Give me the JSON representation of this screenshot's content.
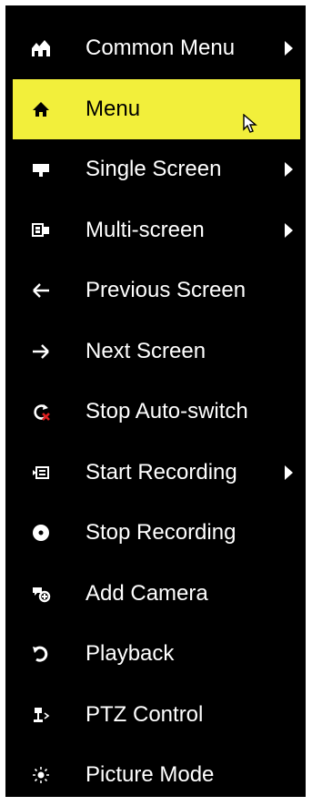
{
  "menu": {
    "items": [
      {
        "label": "Common Menu",
        "icon": "double-house-icon",
        "submenu": true
      },
      {
        "label": "Menu",
        "icon": "home-icon",
        "submenu": false,
        "highlighted": true
      },
      {
        "label": "Single Screen",
        "icon": "monitor-icon",
        "submenu": true
      },
      {
        "label": "Multi-screen",
        "icon": "multi-screen-icon",
        "submenu": true
      },
      {
        "label": "Previous Screen",
        "icon": "arrow-left-icon",
        "submenu": false
      },
      {
        "label": "Next Screen",
        "icon": "arrow-right-icon",
        "submenu": false
      },
      {
        "label": "Stop Auto-switch",
        "icon": "stop-auto-switch-icon",
        "submenu": false
      },
      {
        "label": "Start Recording",
        "icon": "start-recording-icon",
        "submenu": true
      },
      {
        "label": "Stop Recording",
        "icon": "stop-recording-icon",
        "submenu": false
      },
      {
        "label": "Add Camera",
        "icon": "add-camera-icon",
        "submenu": false
      },
      {
        "label": "Playback",
        "icon": "playback-icon",
        "submenu": false
      },
      {
        "label": "PTZ Control",
        "icon": "ptz-control-icon",
        "submenu": false
      },
      {
        "label": "Picture Mode",
        "icon": "picture-mode-icon",
        "submenu": false
      }
    ]
  },
  "colors": {
    "background": "#000000",
    "highlight": "#f2ef3b",
    "text": "#ffffff",
    "highlight_text": "#000000",
    "stop_auto_switch_accent": "#e02020"
  }
}
